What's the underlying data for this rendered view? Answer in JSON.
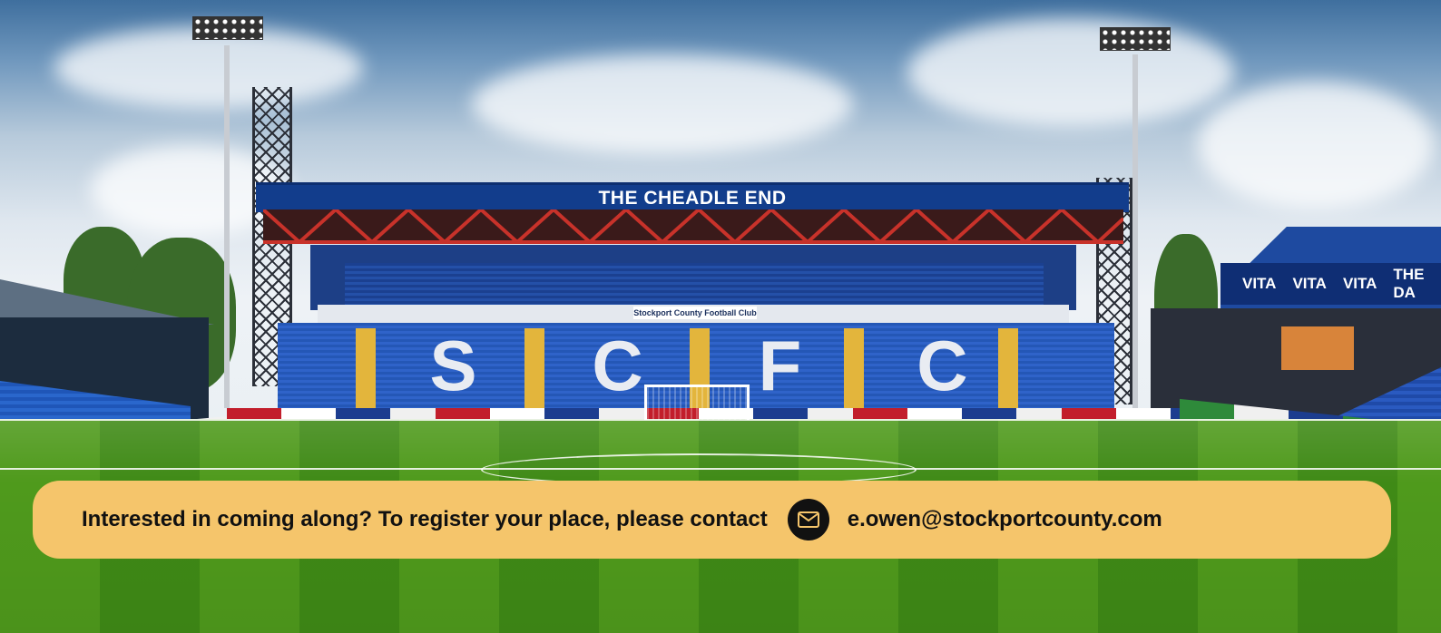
{
  "stand": {
    "roof_sign": "THE CHEADLE END",
    "concourse_banner": "Stockport County Football Club",
    "seat_letters": [
      "S",
      "C",
      "F",
      "C"
    ]
  },
  "right_stand": {
    "band_words": [
      "VITA",
      "VITA",
      "VITA",
      "THE DA"
    ]
  },
  "cta": {
    "text": "Interested in coming along? To register your place, please contact",
    "icon": "envelope-icon",
    "email": "e.owen@stockportcounty.com",
    "background": "#f5c56b"
  }
}
